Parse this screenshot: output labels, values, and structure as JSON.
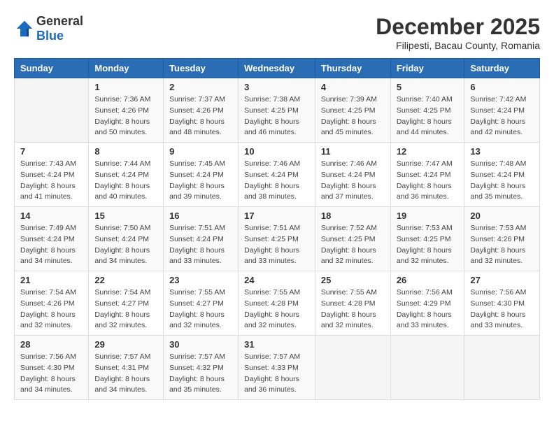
{
  "header": {
    "logo_general": "General",
    "logo_blue": "Blue",
    "title": "December 2025",
    "subtitle": "Filipesti, Bacau County, Romania"
  },
  "days_of_week": [
    "Sunday",
    "Monday",
    "Tuesday",
    "Wednesday",
    "Thursday",
    "Friday",
    "Saturday"
  ],
  "weeks": [
    [
      {
        "day": "",
        "sunrise": "",
        "sunset": "",
        "daylight": ""
      },
      {
        "day": "1",
        "sunrise": "Sunrise: 7:36 AM",
        "sunset": "Sunset: 4:26 PM",
        "daylight": "Daylight: 8 hours and 50 minutes."
      },
      {
        "day": "2",
        "sunrise": "Sunrise: 7:37 AM",
        "sunset": "Sunset: 4:26 PM",
        "daylight": "Daylight: 8 hours and 48 minutes."
      },
      {
        "day": "3",
        "sunrise": "Sunrise: 7:38 AM",
        "sunset": "Sunset: 4:25 PM",
        "daylight": "Daylight: 8 hours and 46 minutes."
      },
      {
        "day": "4",
        "sunrise": "Sunrise: 7:39 AM",
        "sunset": "Sunset: 4:25 PM",
        "daylight": "Daylight: 8 hours and 45 minutes."
      },
      {
        "day": "5",
        "sunrise": "Sunrise: 7:40 AM",
        "sunset": "Sunset: 4:25 PM",
        "daylight": "Daylight: 8 hours and 44 minutes."
      },
      {
        "day": "6",
        "sunrise": "Sunrise: 7:42 AM",
        "sunset": "Sunset: 4:24 PM",
        "daylight": "Daylight: 8 hours and 42 minutes."
      }
    ],
    [
      {
        "day": "7",
        "sunrise": "Sunrise: 7:43 AM",
        "sunset": "Sunset: 4:24 PM",
        "daylight": "Daylight: 8 hours and 41 minutes."
      },
      {
        "day": "8",
        "sunrise": "Sunrise: 7:44 AM",
        "sunset": "Sunset: 4:24 PM",
        "daylight": "Daylight: 8 hours and 40 minutes."
      },
      {
        "day": "9",
        "sunrise": "Sunrise: 7:45 AM",
        "sunset": "Sunset: 4:24 PM",
        "daylight": "Daylight: 8 hours and 39 minutes."
      },
      {
        "day": "10",
        "sunrise": "Sunrise: 7:46 AM",
        "sunset": "Sunset: 4:24 PM",
        "daylight": "Daylight: 8 hours and 38 minutes."
      },
      {
        "day": "11",
        "sunrise": "Sunrise: 7:46 AM",
        "sunset": "Sunset: 4:24 PM",
        "daylight": "Daylight: 8 hours and 37 minutes."
      },
      {
        "day": "12",
        "sunrise": "Sunrise: 7:47 AM",
        "sunset": "Sunset: 4:24 PM",
        "daylight": "Daylight: 8 hours and 36 minutes."
      },
      {
        "day": "13",
        "sunrise": "Sunrise: 7:48 AM",
        "sunset": "Sunset: 4:24 PM",
        "daylight": "Daylight: 8 hours and 35 minutes."
      }
    ],
    [
      {
        "day": "14",
        "sunrise": "Sunrise: 7:49 AM",
        "sunset": "Sunset: 4:24 PM",
        "daylight": "Daylight: 8 hours and 34 minutes."
      },
      {
        "day": "15",
        "sunrise": "Sunrise: 7:50 AM",
        "sunset": "Sunset: 4:24 PM",
        "daylight": "Daylight: 8 hours and 34 minutes."
      },
      {
        "day": "16",
        "sunrise": "Sunrise: 7:51 AM",
        "sunset": "Sunset: 4:24 PM",
        "daylight": "Daylight: 8 hours and 33 minutes."
      },
      {
        "day": "17",
        "sunrise": "Sunrise: 7:51 AM",
        "sunset": "Sunset: 4:25 PM",
        "daylight": "Daylight: 8 hours and 33 minutes."
      },
      {
        "day": "18",
        "sunrise": "Sunrise: 7:52 AM",
        "sunset": "Sunset: 4:25 PM",
        "daylight": "Daylight: 8 hours and 32 minutes."
      },
      {
        "day": "19",
        "sunrise": "Sunrise: 7:53 AM",
        "sunset": "Sunset: 4:25 PM",
        "daylight": "Daylight: 8 hours and 32 minutes."
      },
      {
        "day": "20",
        "sunrise": "Sunrise: 7:53 AM",
        "sunset": "Sunset: 4:26 PM",
        "daylight": "Daylight: 8 hours and 32 minutes."
      }
    ],
    [
      {
        "day": "21",
        "sunrise": "Sunrise: 7:54 AM",
        "sunset": "Sunset: 4:26 PM",
        "daylight": "Daylight: 8 hours and 32 minutes."
      },
      {
        "day": "22",
        "sunrise": "Sunrise: 7:54 AM",
        "sunset": "Sunset: 4:27 PM",
        "daylight": "Daylight: 8 hours and 32 minutes."
      },
      {
        "day": "23",
        "sunrise": "Sunrise: 7:55 AM",
        "sunset": "Sunset: 4:27 PM",
        "daylight": "Daylight: 8 hours and 32 minutes."
      },
      {
        "day": "24",
        "sunrise": "Sunrise: 7:55 AM",
        "sunset": "Sunset: 4:28 PM",
        "daylight": "Daylight: 8 hours and 32 minutes."
      },
      {
        "day": "25",
        "sunrise": "Sunrise: 7:55 AM",
        "sunset": "Sunset: 4:28 PM",
        "daylight": "Daylight: 8 hours and 32 minutes."
      },
      {
        "day": "26",
        "sunrise": "Sunrise: 7:56 AM",
        "sunset": "Sunset: 4:29 PM",
        "daylight": "Daylight: 8 hours and 33 minutes."
      },
      {
        "day": "27",
        "sunrise": "Sunrise: 7:56 AM",
        "sunset": "Sunset: 4:30 PM",
        "daylight": "Daylight: 8 hours and 33 minutes."
      }
    ],
    [
      {
        "day": "28",
        "sunrise": "Sunrise: 7:56 AM",
        "sunset": "Sunset: 4:30 PM",
        "daylight": "Daylight: 8 hours and 34 minutes."
      },
      {
        "day": "29",
        "sunrise": "Sunrise: 7:57 AM",
        "sunset": "Sunset: 4:31 PM",
        "daylight": "Daylight: 8 hours and 34 minutes."
      },
      {
        "day": "30",
        "sunrise": "Sunrise: 7:57 AM",
        "sunset": "Sunset: 4:32 PM",
        "daylight": "Daylight: 8 hours and 35 minutes."
      },
      {
        "day": "31",
        "sunrise": "Sunrise: 7:57 AM",
        "sunset": "Sunset: 4:33 PM",
        "daylight": "Daylight: 8 hours and 36 minutes."
      },
      {
        "day": "",
        "sunrise": "",
        "sunset": "",
        "daylight": ""
      },
      {
        "day": "",
        "sunrise": "",
        "sunset": "",
        "daylight": ""
      },
      {
        "day": "",
        "sunrise": "",
        "sunset": "",
        "daylight": ""
      }
    ]
  ]
}
